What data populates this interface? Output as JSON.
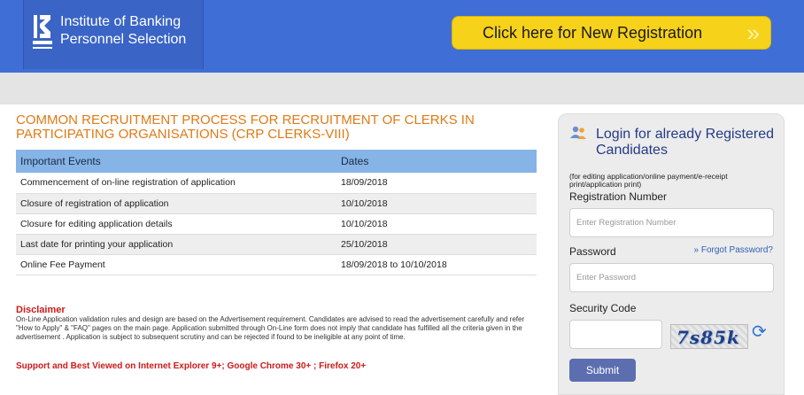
{
  "header": {
    "logo_abbr": "IBPS",
    "logo_line1": "Institute of Banking",
    "logo_line2": "Personnel Selection",
    "registration_button": "Click here for New Registration"
  },
  "main": {
    "title": "COMMON RECRUITMENT PROCESS FOR RECRUITMENT OF CLERKS IN PARTICIPATING ORGANISATIONS (CRP CLERKS-VIII)",
    "table": {
      "headers": [
        "Important Events",
        "Dates"
      ],
      "rows": [
        [
          "Commencement of on-line registration of application",
          "18/09/2018"
        ],
        [
          "Closure of registration of application",
          "10/10/2018"
        ],
        [
          "Closure for editing application details",
          "10/10/2018"
        ],
        [
          "Last date for printing your application",
          "25/10/2018"
        ],
        [
          "Online Fee Payment",
          "18/09/2018 to 10/10/2018"
        ]
      ]
    },
    "disclaimer_title": "Disclaimer",
    "disclaimer_text": "On-Line Application validation rules and design are based on the Advertisement requirement. Candidates are advised to read the advertisement carefully and refer \"How to Apply\" & \"FAQ\" pages on the main page. Application submitted through On-Line form does not imply that candidate has fulfilled all the criteria given in the advertisement . Application is subject to subsequent scrutiny and can be rejected if found to be ineligible at any point of time.",
    "support_text": "Support and Best Viewed on Internet Explorer 9+; Google Chrome 30+ ; Firefox 20+"
  },
  "login": {
    "title": "Login for already Registered Candidates",
    "note": "(for editing application/online payment/e-receipt print/application print)",
    "registration_label": "Registration Number",
    "registration_placeholder": "Enter Registration Number",
    "password_label": "Password",
    "forgot_link": "Forgot Password?",
    "password_placeholder": "Enter Password",
    "security_label": "Security Code",
    "captcha_text": "7s85k",
    "submit_label": "Submit"
  },
  "colors": {
    "header_bg": "#3f6ed6",
    "button_yellow": "#f6d21a",
    "title_orange": "#e07a16",
    "table_header": "#86b4e6",
    "disclaimer_red": "#cc1a1a",
    "submit_bg": "#5c6eb0"
  },
  "icons": [
    "ibps-logo-icon",
    "chevron-right-double-icon",
    "users-icon",
    "refresh-icon"
  ]
}
